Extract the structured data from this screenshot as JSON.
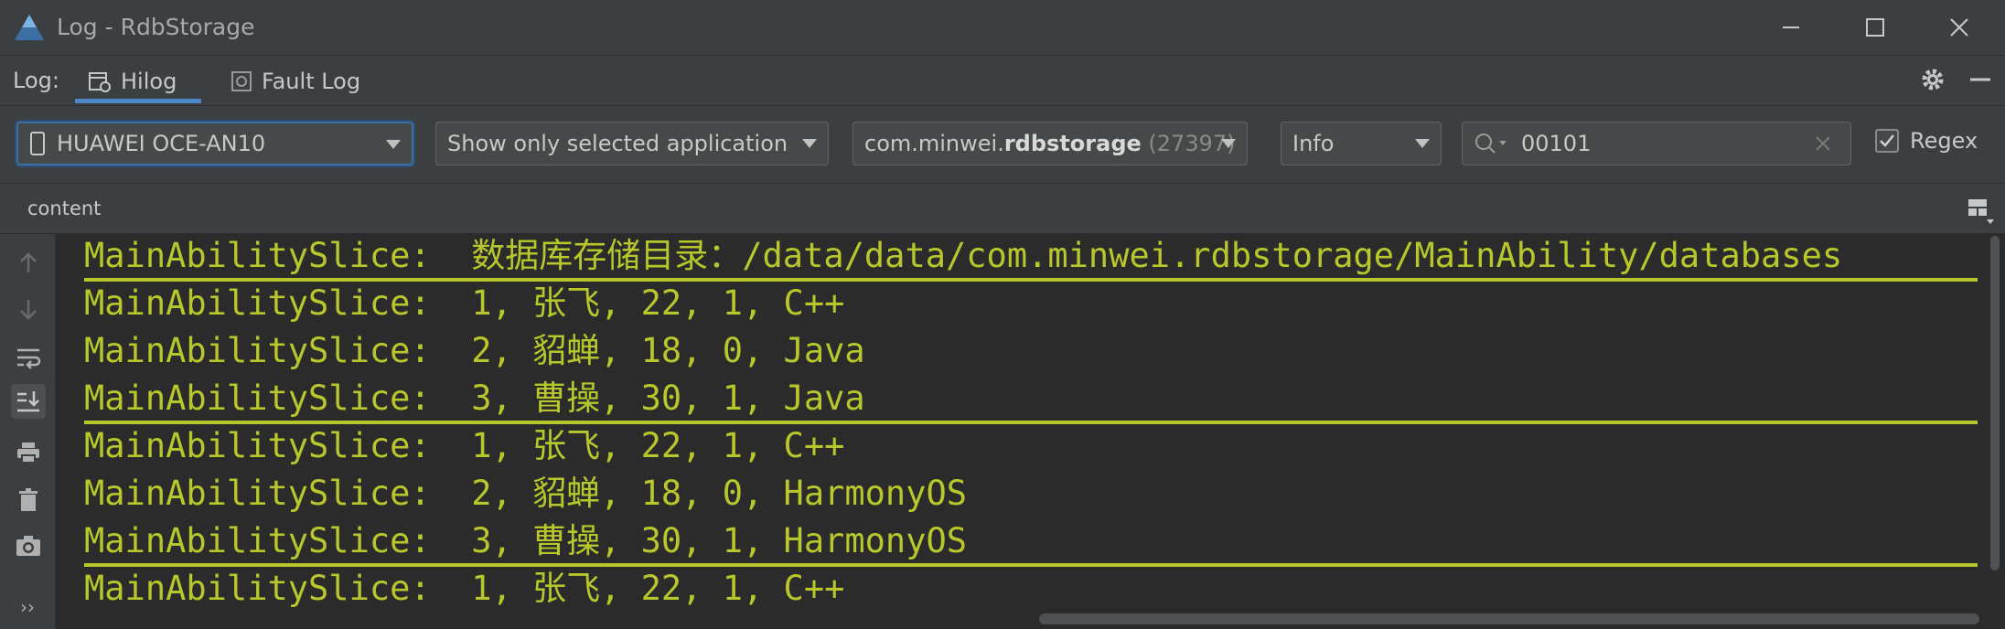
{
  "window": {
    "title": "Log - RdbStorage",
    "accent": "#4a88c7"
  },
  "tabs": {
    "label": "Log:",
    "hilog": "Hilog",
    "faultlog": "Fault Log"
  },
  "filters": {
    "device": "HUAWEI OCE-AN10",
    "app_filter": "Show only selected application",
    "process_prefix": "com.minwei.",
    "process_bold": "rdbstorage",
    "process_pid": " (27397)",
    "level": "Info",
    "search_value": "00101",
    "regex_label": "Regex",
    "regex_checked": true
  },
  "columns": {
    "content": "content"
  },
  "log_lines": [
    "MainAbilitySlice:  数据库存储目录：/data/data/com.minwei.rdbstorage/MainAbility/databases",
    "MainAbilitySlice:  1, 张飞, 22, 1, C++",
    "MainAbilitySlice:  2, 貂蝉, 18, 0, Java",
    "MainAbilitySlice:  3, 曹操, 30, 1, Java",
    "MainAbilitySlice:  1, 张飞, 22, 1, C++",
    "MainAbilitySlice:  2, 貂蝉, 18, 0, HarmonyOS",
    "MainAbilitySlice:  3, 曹操, 30, 1, HarmonyOS",
    "MainAbilitySlice:  1, 张飞, 22, 1, C++"
  ],
  "log_color": "#b8c72b"
}
